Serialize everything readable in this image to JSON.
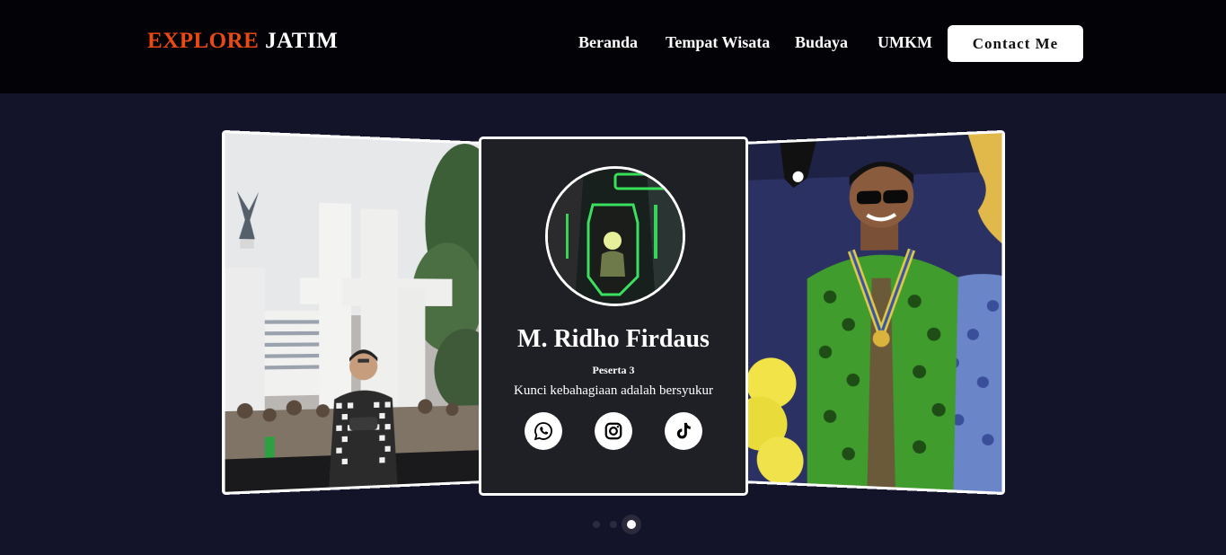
{
  "brand": {
    "accent": "EXPLORE",
    "rest": "JATIM",
    "accent_color": "#ea4a12"
  },
  "nav": {
    "items": [
      {
        "label": "Beranda"
      },
      {
        "label": "Tempat Wisata"
      },
      {
        "label": "Budaya"
      },
      {
        "label": "UMKM"
      }
    ],
    "contact_label": "Contact Me"
  },
  "carousel": {
    "active_card": {
      "name": "M. Ridho Firdaus",
      "role": "Peserta 3",
      "quote": "Kunci kebahagiaan adalah bersyukur",
      "socials": [
        "whatsapp-icon",
        "instagram-icon",
        "tiktok-icon"
      ]
    },
    "dots_count": 3,
    "active_dot": 3
  },
  "colors": {
    "background": "#13132a",
    "navbar": "#030307",
    "card": "#1f2026"
  }
}
